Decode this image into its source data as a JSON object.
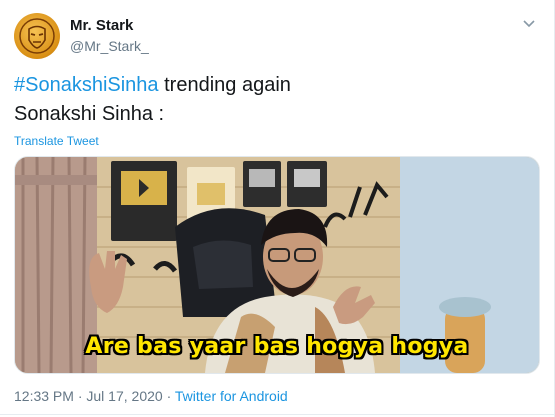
{
  "tweet": {
    "display_name": "Mr. Stark",
    "handle": "@Mr_Stark_",
    "text_hashtag": "#SonakshiSinha",
    "text_rest": " trending again",
    "text_line2": "Sonakshi Sinha :",
    "translate_label": "Translate Tweet",
    "media_caption": "Are bas yaar bas hogya hogya",
    "time": "12:33 PM",
    "separator": " · ",
    "date": "Jul 17, 2020",
    "source": "Twitter for Android"
  },
  "icons": {
    "avatar": "iron-man-helmet-icon",
    "menu": "chevron-down-icon"
  },
  "colors": {
    "link": "#1b95e0",
    "text": "#14171a",
    "secondary": "#657786",
    "caption": "#ffe600"
  }
}
